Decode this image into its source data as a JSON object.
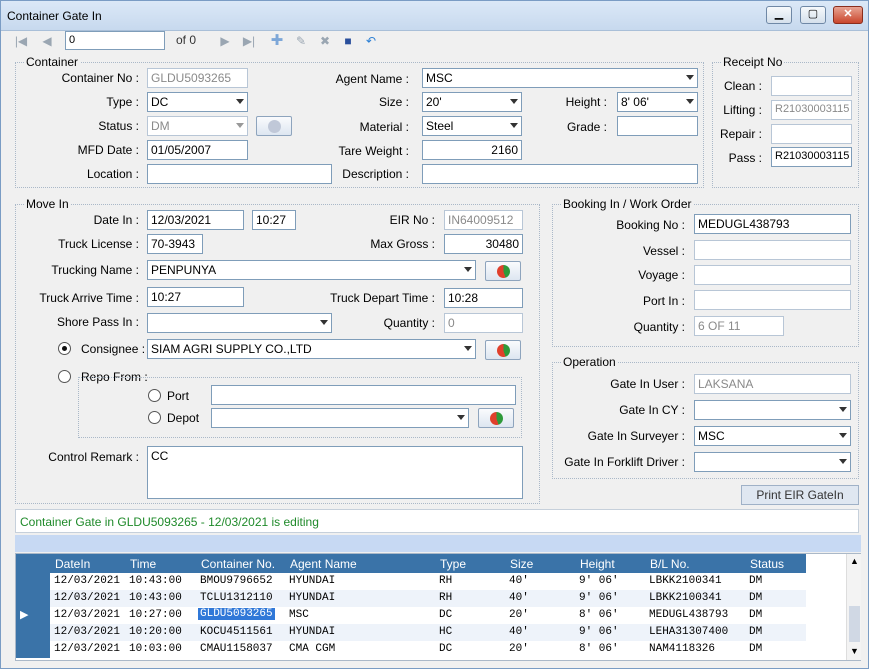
{
  "window": {
    "title": "Container Gate In"
  },
  "toolbar": {
    "position": "0",
    "of": "of  0"
  },
  "container": {
    "group": "Container",
    "no_label": "Container No :",
    "no_value": "GLDU5093265",
    "type_label": "Type :",
    "type_value": "DC",
    "status_label": "Status :",
    "status_value": "DM",
    "mfd_label": "MFD Date :",
    "mfd_value": "01/05/2007",
    "location_label": "Location :",
    "location_value": "",
    "agent_label": "Agent Name :",
    "agent_value": "MSC",
    "size_label": "Size :",
    "size_value": "20'",
    "height_label": "Height :",
    "height_value": "8' 06'",
    "material_label": "Material :",
    "material_value": "Steel",
    "grade_label": "Grade :",
    "grade_value": "",
    "tare_label": "Tare Weight :",
    "tare_value": "2160",
    "desc_label": "Description :",
    "desc_value": ""
  },
  "receipt": {
    "group": "Receipt No",
    "clean_label": "Clean :",
    "clean_value": "",
    "lifting_label": "Lifting :",
    "lifting_value": "R21030003115",
    "repair_label": "Repair :",
    "repair_value": "",
    "pass_label": "Pass :",
    "pass_value": "R21030003115"
  },
  "movein": {
    "group": "Move In",
    "date_label": "Date In :",
    "date_value": "12/03/2021",
    "time_value": "10:27",
    "eir_label": "EIR No :",
    "eir_value": "IN64009512",
    "truck_label": "Truck License :",
    "truck_value": "70-3943",
    "maxgross_label": "Max Gross :",
    "maxgross_value": "30480",
    "trucking_label": "Trucking Name :",
    "trucking_value": "PENPUNYA",
    "arrive_label": "Truck Arrive Time :",
    "arrive_value": "10:27",
    "depart_label": "Truck Depart Time :",
    "depart_value": "10:28",
    "shore_label": "Shore Pass In :",
    "shore_value": "",
    "qty_label": "Quantity :",
    "qty_value": "0",
    "consignee_label": "Consignee :",
    "consignee_value": "SIAM AGRI SUPPLY CO.,LTD",
    "repo_label": "Repo From :",
    "port_label": "Port",
    "port_value": "",
    "depot_label": "Depot",
    "depot_value": "",
    "remark_label": "Control Remark :",
    "remark_value": "CC"
  },
  "booking": {
    "group": "Booking In / Work Order",
    "no_label": "Booking No :",
    "no_value": "MEDUGL438793",
    "vessel_label": "Vessel :",
    "vessel_value": "",
    "voyage_label": "Voyage :",
    "voyage_value": "",
    "port_label": "Port In :",
    "port_value": "",
    "qty_label": "Quantity :",
    "qty_value": "6 OF 11"
  },
  "operation": {
    "group": "Operation",
    "user_label": "Gate In User :",
    "user_value": "LAKSANA",
    "cy_label": "Gate In CY :",
    "cy_value": "",
    "surveyer_label": "Gate In Surveyer :",
    "surveyer_value": "MSC",
    "forklift_label": "Gate In Forklift Driver :",
    "forklift_value": ""
  },
  "print_button": "Print EIR GateIn",
  "status_text": "Container Gate in GLDU5093265 - 12/03/2021 is editing",
  "grid": {
    "headers": [
      "DateIn",
      "Time",
      "Container No.",
      "Agent Name",
      "Type",
      "Size",
      "Height",
      "B/L No.",
      "Status"
    ],
    "rows": [
      [
        "12/03/2021",
        "10:43:00",
        "BMOU9796652",
        "HYUNDAI",
        "RH",
        "40'",
        "9' 06'",
        "LBKK2100341",
        "DM"
      ],
      [
        "12/03/2021",
        "10:43:00",
        "TCLU1312110",
        "HYUNDAI",
        "RH",
        "40'",
        "9' 06'",
        "LBKK2100341",
        "DM"
      ],
      [
        "12/03/2021",
        "10:27:00",
        "GLDU5093265",
        "MSC",
        "DC",
        "20'",
        "8' 06'",
        "MEDUGL438793",
        "DM"
      ],
      [
        "12/03/2021",
        "10:20:00",
        "KOCU4511561",
        "HYUNDAI",
        "HC",
        "40'",
        "9' 06'",
        "LEHA31307400",
        "DM"
      ],
      [
        "12/03/2021",
        "10:03:00",
        "CMAU1158037",
        "CMA CGM",
        "DC",
        "20'",
        "8' 06'",
        "NAM4118326",
        "DM"
      ]
    ]
  }
}
